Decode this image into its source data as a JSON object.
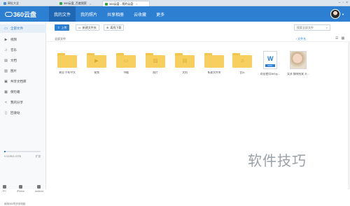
{
  "browser": {
    "tabs": [
      {
        "label": "网址大全"
      },
      {
        "label": "360云盘_百度搜索"
      },
      {
        "label": "360云盘 - 我的云盘"
      }
    ]
  },
  "header": {
    "logo_text": "360云盘",
    "nav": [
      {
        "label": "我的文件"
      },
      {
        "label": "我的照片"
      },
      {
        "label": "共享相册"
      },
      {
        "label": "云收藏"
      },
      {
        "label": "更多"
      }
    ]
  },
  "sidebar": {
    "items": [
      {
        "label": "全部文件",
        "icon": "folder-icon"
      },
      {
        "label": "视频",
        "icon": "video-icon"
      },
      {
        "label": "音乐",
        "icon": "music-icon"
      },
      {
        "label": "文档",
        "icon": "document-icon"
      },
      {
        "label": "图片",
        "icon": "image-icon"
      },
      {
        "label": "共享文档库",
        "icon": "shared-library-icon"
      },
      {
        "label": "保险箱",
        "icon": "safe-icon"
      },
      {
        "label": "我的分享",
        "icon": "share-icon"
      },
      {
        "label": "回收站",
        "icon": "trash-icon"
      }
    ],
    "storage": {
      "used": "0.11GB/1.01TB",
      "expand_label": "扩容",
      "used_fraction": 0.04
    },
    "devices": [
      {
        "label": "PC"
      },
      {
        "label": "iPhone"
      },
      {
        "label": "Android"
      }
    ],
    "sync_text": "使用360同步到电脑"
  },
  "toolbar": {
    "upload_label": "上传",
    "new_folder_label": "新建文件夹",
    "offline_download_label": "离线下载",
    "search_placeholder": "搜索全部文件"
  },
  "breadcrumb": {
    "label": "全部文件"
  },
  "sort_label": "文件名",
  "files": [
    {
      "name": "来自:手机中文",
      "kind": "folder",
      "glyph": ""
    },
    {
      "name": "视频",
      "kind": "folder",
      "glyph": "▶"
    },
    {
      "name": "书籍",
      "kind": "folder",
      "glyph": "▭"
    },
    {
      "name": "图片",
      "kind": "folder",
      "glyph": "▨"
    },
    {
      "name": "文档",
      "kind": "folder",
      "glyph": "▤"
    },
    {
      "name": "新建文件夹",
      "kind": "folder",
      "glyph": ""
    },
    {
      "name": "音乐",
      "kind": "folder",
      "glyph": "♫"
    },
    {
      "name": "欢迎使用360云...",
      "kind": "doc",
      "glyph": "W",
      "tag": "DOC"
    },
    {
      "name": "女孩 猫咪图案 头...",
      "kind": "photo",
      "glyph": ""
    }
  ],
  "watermark": "软件技巧"
}
